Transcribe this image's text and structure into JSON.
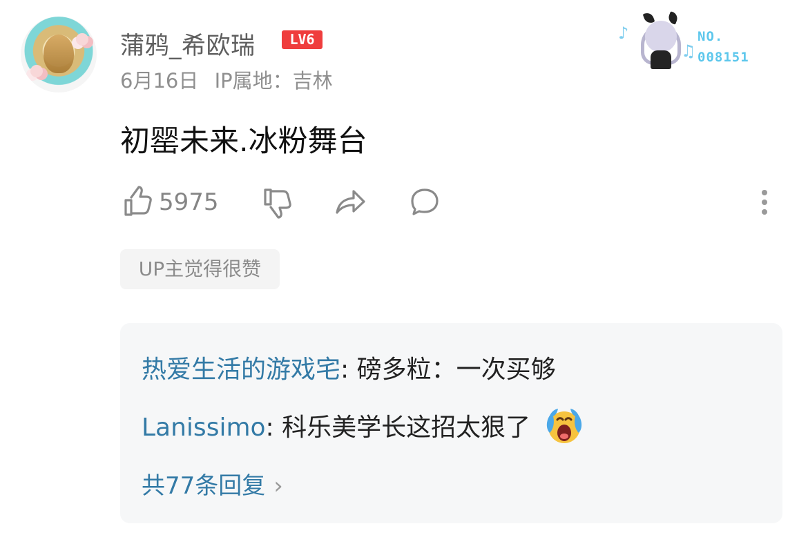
{
  "author": {
    "name": "蒲鸦_希欧瑞",
    "level": "LV6",
    "date": "6月16日",
    "ip_location": "IP属地：吉林"
  },
  "fan_badge": {
    "number_label": "NO.",
    "number": "008151"
  },
  "comment": {
    "text": "初罂未来.冰粉舞台"
  },
  "actions": {
    "like_count": "5975",
    "icons": [
      "thumbs-up-icon",
      "thumbs-down-icon",
      "share-icon",
      "comment-icon",
      "more-icon"
    ]
  },
  "up_tag": "UP主觉得很赞",
  "replies": [
    {
      "author": "热爱生活的游戏宅",
      "text": "磅多粒：一次买够"
    },
    {
      "author": "Lanissimo",
      "text": "科乐美学长这招太狠了",
      "emoji": "crying-face-icon"
    }
  ],
  "reply_count": "共77条回复",
  "colors": {
    "link_blue": "#337aa6",
    "level_red": "#ef3d3d",
    "fan_blue": "#5dc7ec"
  }
}
